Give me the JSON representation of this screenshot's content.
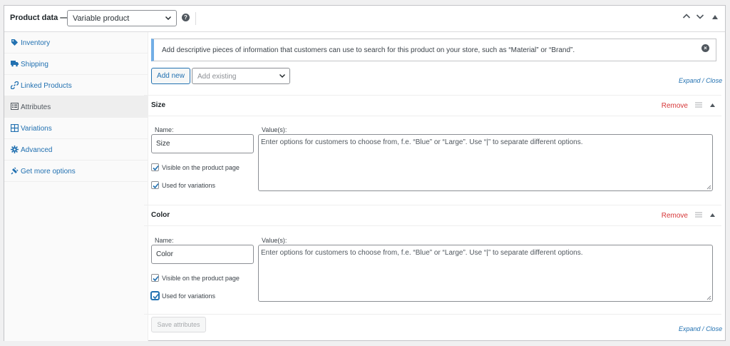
{
  "header": {
    "title": "Product data —",
    "product_type": "Variable product",
    "help_icon": "help-icon",
    "collapse_all_icon": "chevron-up-icon",
    "expand_all_icon": "chevron-down-icon",
    "toggle_icon": "triangle-up-icon"
  },
  "sidebar": {
    "items": [
      {
        "label": "Inventory",
        "icon": "tag-icon"
      },
      {
        "label": "Shipping",
        "icon": "truck-icon"
      },
      {
        "label": "Linked Products",
        "icon": "link-icon"
      },
      {
        "label": "Attributes",
        "icon": "list-icon",
        "active": true
      },
      {
        "label": "Variations",
        "icon": "grid-icon"
      },
      {
        "label": "Advanced",
        "icon": "gear-icon"
      },
      {
        "label": "Get more options",
        "icon": "plugin-icon"
      }
    ]
  },
  "notice": {
    "text": "Add descriptive pieces of information that customers can use to search for this product on your store, such as “Material” or “Brand”."
  },
  "toolbar": {
    "add_new": "Add new",
    "add_existing_placeholder": "Add existing",
    "expand": "Expand",
    "close": "Close"
  },
  "attributes": [
    {
      "name": "Size",
      "remove": "Remove",
      "name_label": "Name:",
      "name_value": "Size",
      "values_label": "Value(s):",
      "values_placeholder": "Enter options for customers to choose from, f.e. “Blue” or “Large”. Use “|” to separate different options.",
      "visible_label": "Visible on the product page",
      "visible_checked": true,
      "variations_label": "Used for variations",
      "variations_checked": true
    },
    {
      "name": "Color",
      "remove": "Remove",
      "name_label": "Name:",
      "name_value": "Color",
      "values_label": "Value(s):",
      "values_placeholder": "Enter options for customers to choose from, f.e. “Blue” or “Large”. Use “|” to separate different options.",
      "visible_label": "Visible on the product page",
      "visible_checked": true,
      "variations_label": "Used for variations",
      "variations_checked": true
    }
  ],
  "footer": {
    "save": "Save attributes",
    "expand": "Expand",
    "close": "Close"
  },
  "colors": {
    "link": "#2271b1",
    "remove": "#d63638",
    "notice_accent": "#72aee6"
  }
}
